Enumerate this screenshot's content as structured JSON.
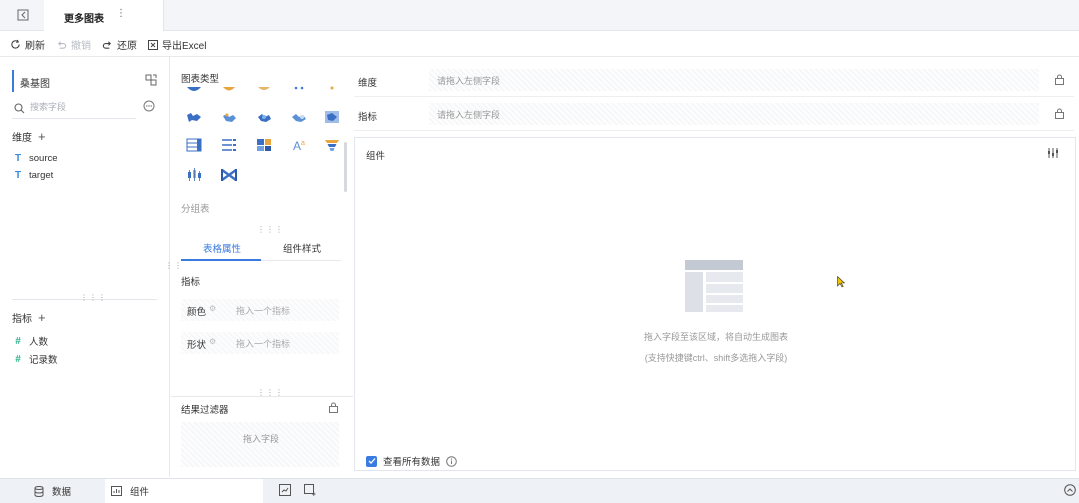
{
  "tab": {
    "title": "更多图表",
    "more": "⋮"
  },
  "toolbar": {
    "refresh": "刷新",
    "undo": "撤销",
    "redo": "还原",
    "export": "导出Excel"
  },
  "left": {
    "dataset": "桑基图",
    "search_placeholder": "搜索字段",
    "dimension_title": "维度",
    "dimension_fields": [
      "source",
      "target"
    ],
    "measure_title": "指标",
    "measure_fields": [
      "人数",
      "记录数"
    ]
  },
  "mid": {
    "chart_type_title": "图表类型",
    "group_label": "分组表",
    "tabs": [
      "表格属性",
      "组件样式"
    ],
    "measure_title": "指标",
    "props": [
      {
        "label": "颜色",
        "placeholder": "拖入一个指标"
      },
      {
        "label": "形状",
        "placeholder": "拖入一个指标"
      }
    ],
    "filter_title": "结果过滤器",
    "filter_placeholder": "拖入字段"
  },
  "right": {
    "dimension_label": "维度",
    "dimension_placeholder": "请拖入左侧字段",
    "measure_label": "指标",
    "measure_placeholder": "请拖入左侧字段",
    "widget_title": "组件",
    "empty_line1": "拖入字段至该区域，将自动生成图表",
    "empty_line2": "(支持快捷键ctrl、shift多选拖入字段)",
    "view_all": "查看所有数据"
  },
  "bottom": {
    "data_tab": "数据",
    "widget_tab": "组件"
  },
  "colors": {
    "accent": "#3a7be0",
    "dimension": "#3b8bd9",
    "measure": "#2bae8a"
  }
}
